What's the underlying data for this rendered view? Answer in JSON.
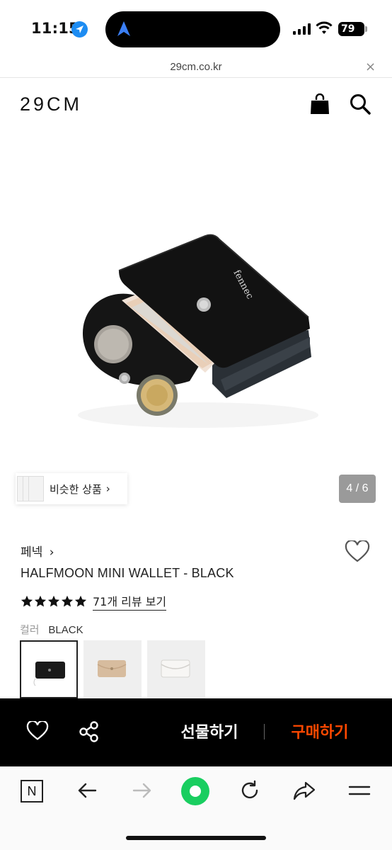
{
  "status_bar": {
    "time": "11:15",
    "battery": "79",
    "icons": [
      "location-icon",
      "navigation-arrow-icon",
      "signal-icon",
      "wifi-icon",
      "battery-icon"
    ]
  },
  "browser": {
    "url": "29cm.co.kr",
    "close_icon": "×"
  },
  "header": {
    "logo": "29CM",
    "icons": [
      "shopping-bag-icon",
      "search-icon"
    ]
  },
  "gallery": {
    "similar_label": "비슷한 상품",
    "similar_chevron": "›",
    "page_indicator": "4 / 6"
  },
  "product": {
    "brand": "페넥",
    "brand_chevron": "›",
    "name": "HALFMOON MINI WALLET - BLACK",
    "rating_stars": 5,
    "review_link": "71개 리뷰 보기",
    "color_label": "컬러",
    "color_value": "BLACK",
    "swatches": [
      {
        "name": "black",
        "color": "#1a1a1a",
        "selected": true
      },
      {
        "name": "beige",
        "color": "#d7bc9e",
        "selected": false
      },
      {
        "name": "white",
        "color": "#e8e6e3",
        "selected": false
      }
    ]
  },
  "action_bar": {
    "gift_label": "선물하기",
    "buy_label": "구매하기",
    "buy_color": "#ff4800"
  },
  "toolbar": {
    "icons": [
      "naver-n-icon",
      "back-arrow-icon",
      "forward-arrow-icon",
      "green-home-icon",
      "refresh-icon",
      "share-icon",
      "menu-icon"
    ],
    "naver_label": "N",
    "accent": "#19ce60"
  }
}
